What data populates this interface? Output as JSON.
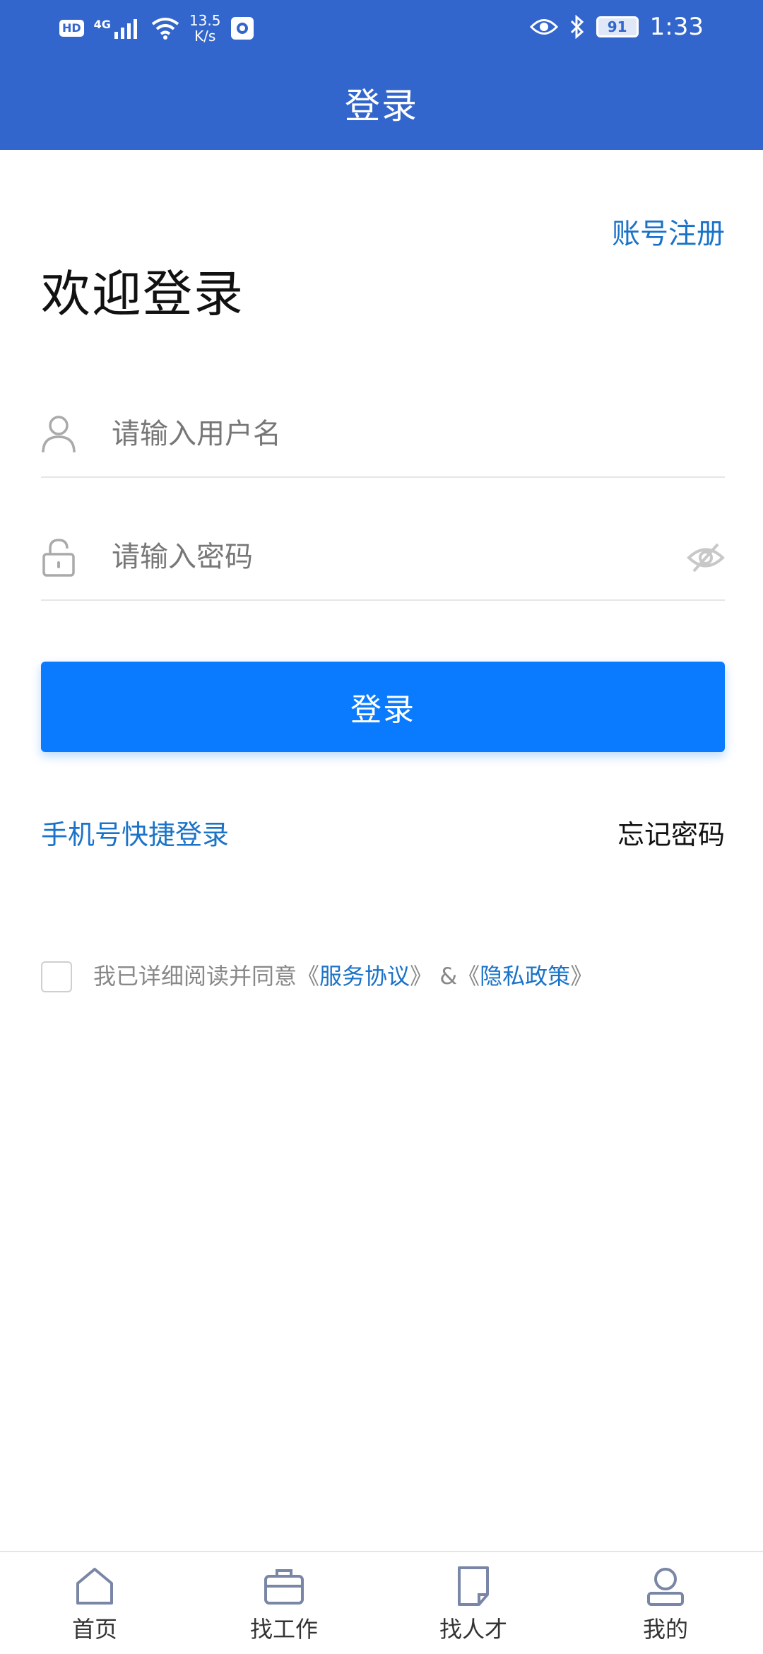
{
  "status_bar": {
    "hd": "HD",
    "signal": "4G",
    "net_speed_value": "13.5",
    "net_speed_unit": "K/s",
    "battery": "91",
    "time": "1:33",
    "icons": [
      "wifi-icon",
      "screen-record-icon",
      "eye-comfort-icon",
      "bluetooth-icon",
      "battery-icon"
    ]
  },
  "header": {
    "title": "登录"
  },
  "register_link": "账号注册",
  "welcome": "欢迎登录",
  "form": {
    "username": {
      "value": "",
      "placeholder": "请输入用户名",
      "icon": "user-icon"
    },
    "password": {
      "value": "",
      "placeholder": "请输入密码",
      "icon": "lock-icon",
      "toggle_icon": "eye-hidden-icon"
    }
  },
  "login_button": "登录",
  "phone_login": "手机号快捷登录",
  "forgot_password": "忘记密码",
  "agreement": {
    "checked": false,
    "prefix": "我已详细阅读并同意《",
    "service": "服务协议",
    "middle": "》 &《",
    "privacy": "隐私政策",
    "suffix": "》"
  },
  "bottom_nav": [
    {
      "label": "首页",
      "icon": "home-icon"
    },
    {
      "label": "找工作",
      "icon": "briefcase-icon"
    },
    {
      "label": "找人才",
      "icon": "document-icon"
    },
    {
      "label": "我的",
      "icon": "profile-icon"
    }
  ],
  "colors": {
    "header": "#3366cc",
    "primary_button": "#0a7bff",
    "link": "#1a73c8"
  }
}
